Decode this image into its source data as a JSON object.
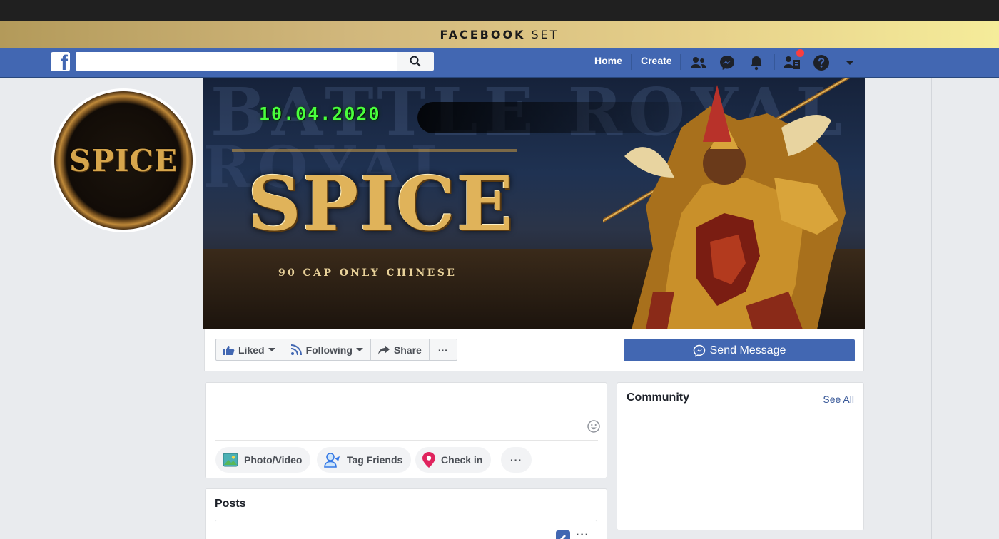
{
  "banner": {
    "bold_text": "FACEBOOK",
    "light_text": "SET"
  },
  "nav": {
    "search_placeholder": "",
    "home_label": "Home",
    "create_label": "Create",
    "logo_letter": "f"
  },
  "profile": {
    "logo_text": "SPICE"
  },
  "cover": {
    "date": "10.04.2020",
    "logo": "SPICE",
    "subtitle": "90 CAP ONLY CHINESE",
    "bg_text_1": "BATTLE ROYAL",
    "bg_text_2": "ROYAL"
  },
  "actions": {
    "liked": "Liked",
    "following": "Following",
    "share": "Share",
    "more": "···",
    "send_message": "Send Message"
  },
  "composer": {
    "photo_video": "Photo/Video",
    "tag_friends": "Tag Friends",
    "check_in": "Check in",
    "more": "···"
  },
  "posts": {
    "title": "Posts",
    "more": "···"
  },
  "community": {
    "title": "Community",
    "see_all": "See All"
  },
  "colors": {
    "fb_blue": "#4267b2",
    "check_in_red": "#e0245e",
    "cover_date_green": "#49ff3c",
    "gold": "#e0b35a"
  }
}
